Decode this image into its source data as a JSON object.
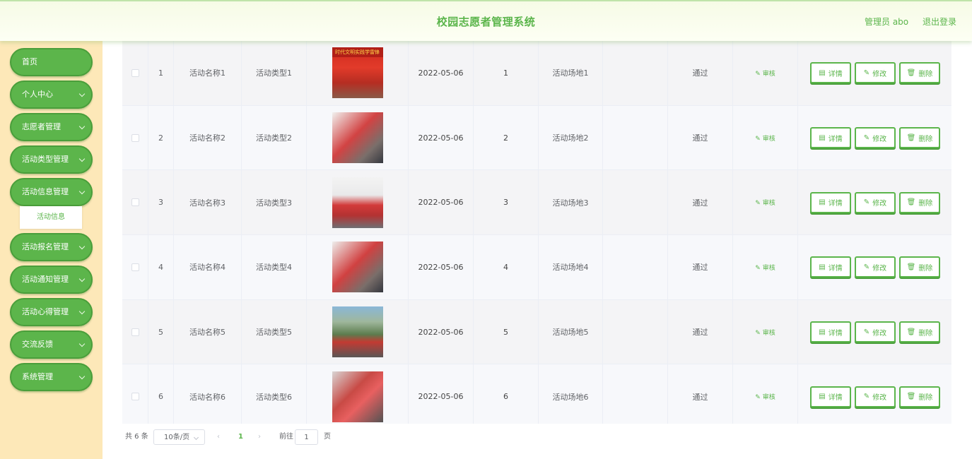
{
  "header": {
    "title": "校园志愿者管理系统",
    "user_label": "管理员 abo",
    "logout_label": "退出登录"
  },
  "sidebar": {
    "items": [
      {
        "label": "首页",
        "has_arrow": false
      },
      {
        "label": "个人中心",
        "has_arrow": true
      },
      {
        "label": "志愿者管理",
        "has_arrow": true
      },
      {
        "label": "活动类型管理",
        "has_arrow": true
      },
      {
        "label": "活动信息管理",
        "has_arrow": true
      },
      {
        "label": "活动报名管理",
        "has_arrow": true
      },
      {
        "label": "活动通知管理",
        "has_arrow": true
      },
      {
        "label": "活动心得管理",
        "has_arrow": true
      },
      {
        "label": "交流反馈",
        "has_arrow": true
      },
      {
        "label": "系统管理",
        "has_arrow": true
      }
    ],
    "active_submenu": "活动信息"
  },
  "table": {
    "rows": [
      {
        "index": "1",
        "name": "活动名称1",
        "type": "活动类型1",
        "date": "2022-05-06",
        "num": "1",
        "venue": "活动场地1",
        "extra": "",
        "status": "通过",
        "audit": "审核",
        "photo_banner": "时代文明实践学雷锋"
      },
      {
        "index": "2",
        "name": "活动名称2",
        "type": "活动类型2",
        "date": "2022-05-06",
        "num": "2",
        "venue": "活动场地2",
        "extra": "",
        "status": "通过",
        "audit": "审核",
        "photo_banner": ""
      },
      {
        "index": "3",
        "name": "活动名称3",
        "type": "活动类型3",
        "date": "2022-05-06",
        "num": "3",
        "venue": "活动场地3",
        "extra": "",
        "status": "通过",
        "audit": "审核",
        "photo_banner": ""
      },
      {
        "index": "4",
        "name": "活动名称4",
        "type": "活动类型4",
        "date": "2022-05-06",
        "num": "4",
        "venue": "活动场地4",
        "extra": "",
        "status": "通过",
        "audit": "审核",
        "photo_banner": ""
      },
      {
        "index": "5",
        "name": "活动名称5",
        "type": "活动类型5",
        "date": "2022-05-06",
        "num": "5",
        "venue": "活动场地5",
        "extra": "",
        "status": "通过",
        "audit": "审核",
        "photo_banner": ""
      },
      {
        "index": "6",
        "name": "活动名称6",
        "type": "活动类型6",
        "date": "2022-05-06",
        "num": "6",
        "venue": "活动场地6",
        "extra": "",
        "status": "通过",
        "audit": "审核",
        "photo_banner": ""
      }
    ],
    "actions": {
      "detail": "详情",
      "edit": "修改",
      "delete": "删除"
    }
  },
  "pagination": {
    "total": "共 6 条",
    "page_size": "10条/页",
    "current": "1",
    "goto_label": "前往",
    "goto_value": "1",
    "page_suffix": "页"
  },
  "colors": {
    "accent": "#5bb54b",
    "sidebar_bg": "#fde8b8",
    "header_bg": "#f6fbe6"
  },
  "icons": {
    "chevron": "chevron-down-icon",
    "audit": "edit-icon",
    "detail": "document-icon",
    "edit": "edit-icon",
    "delete": "trash-icon",
    "prev": "chevron-left-icon",
    "next": "chevron-right-icon"
  }
}
